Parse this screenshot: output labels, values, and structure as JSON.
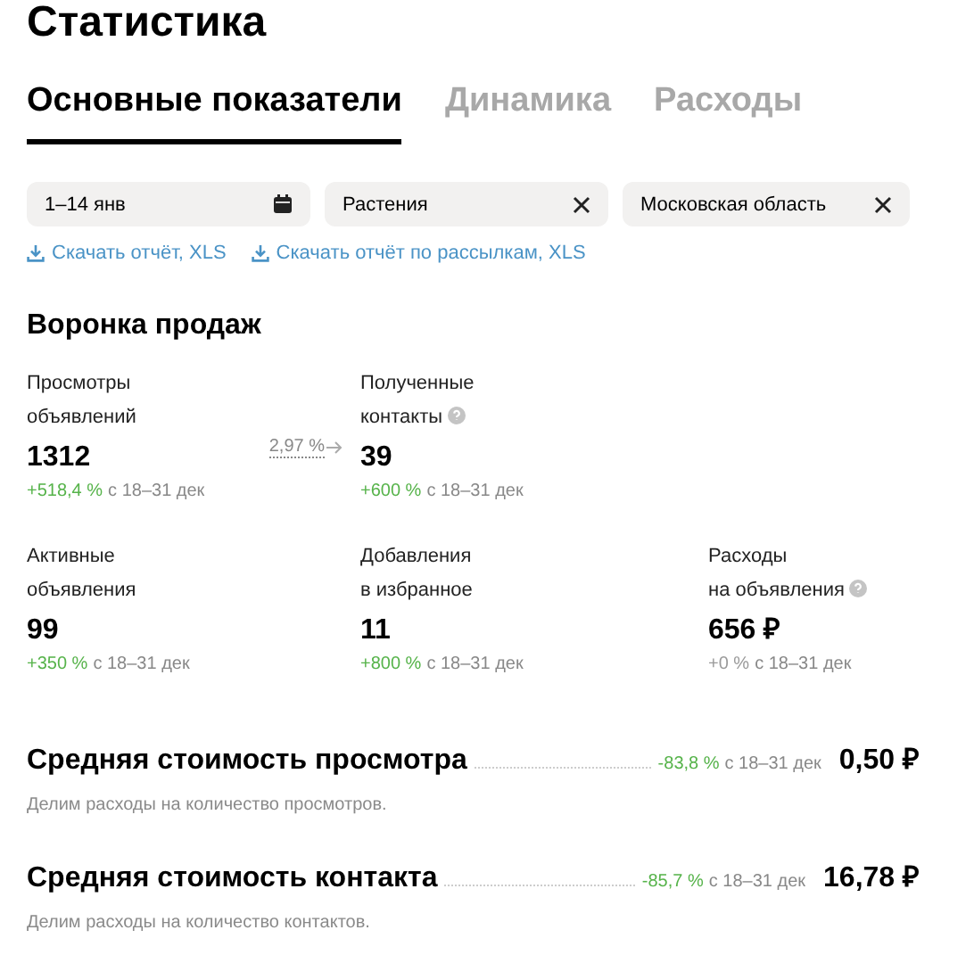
{
  "page_title": "Статистика",
  "tabs": [
    {
      "label": "Основные показатели",
      "selected": true
    },
    {
      "label": "Динамика",
      "selected": false
    },
    {
      "label": "Расходы",
      "selected": false
    }
  ],
  "filters": [
    {
      "kind": "date",
      "value": "1–14 янв"
    },
    {
      "kind": "clearable",
      "value": "Растения"
    },
    {
      "kind": "clearable",
      "value": "Московская область"
    }
  ],
  "downloads": [
    "Скачать отчёт, XLS",
    "Скачать отчёт по рассылкам, XLS"
  ],
  "funnel": {
    "title": "Воронка продаж",
    "rows": [
      {
        "conversion": "2,97 %",
        "metrics": [
          {
            "label": "Просмотры\nобъявлений",
            "hint": false,
            "value": "1312",
            "delta": "+518,4 %",
            "color": "#56b34a",
            "period": "с 18–31 дек"
          },
          {
            "label": "Полученные\nконтакты",
            "hint": true,
            "value": "39",
            "delta": "+600 %",
            "color": "#56b34a",
            "period": "с 18–31 дек"
          }
        ]
      },
      {
        "metrics": [
          {
            "label": "Активные\nобъявления",
            "hint": false,
            "value": "99",
            "delta": "+350 %",
            "color": "#56b34a",
            "period": "с 18–31 дек"
          },
          {
            "label": "Добавления\nв избранное",
            "hint": false,
            "value": "11",
            "delta": "+800 %",
            "color": "#56b34a",
            "period": "с 18–31 дек"
          },
          {
            "label": "Расходы\nна объявления",
            "hint": true,
            "value": "656 ₽",
            "delta": "+0 %",
            "color": "#9a9a9a",
            "period": "с 18–31 дек"
          }
        ]
      }
    ]
  },
  "costs": [
    {
      "title": "Средняя стоимость просмотра",
      "delta": "-83,8 %",
      "color": "#56b34a",
      "period": "с 18–31 дек",
      "value": "0,50 ₽",
      "description": "Делим расходы на количество просмотров."
    },
    {
      "title": "Средняя стоимость контакта",
      "delta": "-85,7 %",
      "color": "#56b34a",
      "period": "с 18–31 дек",
      "value": "16,78 ₽",
      "description": "Делим расходы на количество контактов."
    }
  ]
}
